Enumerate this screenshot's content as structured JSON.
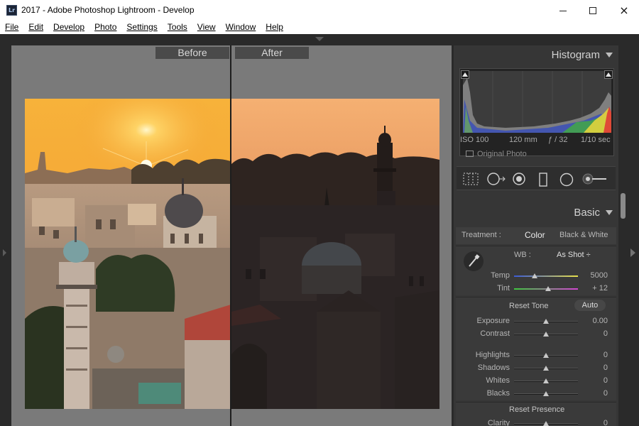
{
  "window": {
    "icon_text": "Lr",
    "title": "2017 - Adobe Photoshop Lightroom - Develop",
    "minimize": "minimize",
    "maximize": "maximize",
    "close": "×"
  },
  "menu": [
    "File",
    "Edit",
    "Develop",
    "Photo",
    "Settings",
    "Tools",
    "View",
    "Window",
    "Help"
  ],
  "viewer": {
    "before_label": "Before",
    "after_label": "After"
  },
  "histogram": {
    "title": "Histogram",
    "iso": "ISO 100",
    "focal_length": "120 mm",
    "aperture": "ƒ / 32",
    "shutter": "1/10 sec",
    "original_photo": "Original Photo"
  },
  "tools": [
    "crop-overlay-icon",
    "spot-removal-icon",
    "red-eye-icon",
    "graduated-filter-icon",
    "radial-filter-icon",
    "adjustment-brush-icon"
  ],
  "basic": {
    "title": "Basic",
    "treatment_label": "Treatment :",
    "treatment_color": "Color",
    "treatment_bw": "Black & White",
    "wb_label": "WB :",
    "wb_value": "As Shot ÷",
    "temp": {
      "label": "Temp",
      "value": "5000",
      "position": 0.32
    },
    "tint": {
      "label": "Tint",
      "value": "+ 12",
      "position": 0.53
    },
    "reset_tone": "Reset Tone",
    "auto": "Auto",
    "exposure": {
      "label": "Exposure",
      "value": "0.00",
      "position": 0.5
    },
    "contrast": {
      "label": "Contrast",
      "value": "0",
      "position": 0.5
    },
    "highlights": {
      "label": "Highlights",
      "value": "0",
      "position": 0.5
    },
    "shadows": {
      "label": "Shadows",
      "value": "0",
      "position": 0.5
    },
    "whites": {
      "label": "Whites",
      "value": "0",
      "position": 0.5
    },
    "blacks": {
      "label": "Blacks",
      "value": "0",
      "position": 0.5
    },
    "reset_presence": "Reset Presence",
    "clarity": {
      "label": "Clarity",
      "value": "0",
      "position": 0.5
    }
  },
  "colors": {
    "app_bg": "#2a2a2a",
    "panel_bg": "#363636",
    "viewer_bg": "#7a7a7a",
    "temp_gradient": [
      "#3b5bd6",
      "#e8e04a"
    ],
    "tint_gradient": [
      "#3fc83f",
      "#d545d5"
    ]
  }
}
